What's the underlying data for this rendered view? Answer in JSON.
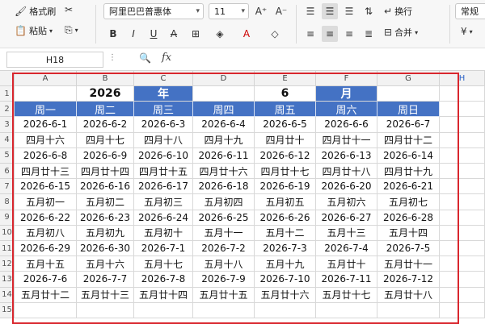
{
  "toolbar": {
    "format_painter": "格式刷",
    "paste": "粘贴",
    "font_name": "阿里巴巴普惠体",
    "font_size": "11",
    "increase_font": "A⁺",
    "decrease_font": "A⁻",
    "wrap_text": "换行",
    "merge": "合并",
    "number_format": "常规"
  },
  "formula_bar": {
    "name_box": "H18",
    "fx": "fx"
  },
  "columns": [
    "A",
    "B",
    "C",
    "D",
    "E",
    "F",
    "G",
    "H"
  ],
  "rows": [
    "1",
    "2",
    "3",
    "4",
    "5",
    "6",
    "7",
    "8",
    "9",
    "10",
    "11",
    "12",
    "13",
    "14",
    "15"
  ],
  "sheet": {
    "row1": [
      "",
      "2026",
      "年",
      "",
      "6",
      "月",
      ""
    ],
    "weekdays": [
      "周一",
      "周二",
      "周三",
      "周四",
      "周五",
      "周六",
      "周日"
    ],
    "body": [
      [
        "2026-6-1",
        "2026-6-2",
        "2026-6-3",
        "2026-6-4",
        "2026-6-5",
        "2026-6-6",
        "2026-6-7"
      ],
      [
        "四月十六",
        "四月十七",
        "四月十八",
        "四月十九",
        "四月廿十",
        "四月廿十一",
        "四月廿十二"
      ],
      [
        "2026-6-8",
        "2026-6-9",
        "2026-6-10",
        "2026-6-11",
        "2026-6-12",
        "2026-6-13",
        "2026-6-14"
      ],
      [
        "四月廿十三",
        "四月廿十四",
        "四月廿十五",
        "四月廿十六",
        "四月廿十七",
        "四月廿十八",
        "四月廿十九"
      ],
      [
        "2026-6-15",
        "2026-6-16",
        "2026-6-17",
        "2026-6-18",
        "2026-6-19",
        "2026-6-20",
        "2026-6-21"
      ],
      [
        "五月初一",
        "五月初二",
        "五月初三",
        "五月初四",
        "五月初五",
        "五月初六",
        "五月初七"
      ],
      [
        "2026-6-22",
        "2026-6-23",
        "2026-6-24",
        "2026-6-25",
        "2026-6-26",
        "2026-6-27",
        "2026-6-28"
      ],
      [
        "五月初八",
        "五月初九",
        "五月初十",
        "五月十一",
        "五月十二",
        "五月十三",
        "五月十四"
      ],
      [
        "2026-6-29",
        "2026-6-30",
        "2026-7-1",
        "2026-7-2",
        "2026-7-3",
        "2026-7-4",
        "2026-7-5"
      ],
      [
        "五月十五",
        "五月十六",
        "五月十七",
        "五月十八",
        "五月十九",
        "五月廿十",
        "五月廿十一"
      ],
      [
        "2026-7-6",
        "2026-7-7",
        "2026-7-8",
        "2026-7-9",
        "2026-7-10",
        "2026-7-11",
        "2026-7-12"
      ],
      [
        "五月廿十二",
        "五月廿十三",
        "五月廿十四",
        "五月廿十五",
        "五月廿十六",
        "五月廿十七",
        "五月廿十八"
      ]
    ]
  },
  "colors": {
    "header_blue": "#4472c4",
    "highlight_red": "#d9272e"
  },
  "icons": [
    "scissors-icon",
    "paste-icon",
    "copy-format-icon",
    "bold-icon",
    "italic-icon",
    "underline-icon",
    "fill-color-icon",
    "font-color-icon",
    "align-left-icon",
    "align-center-icon",
    "align-right-icon",
    "zoom-icon"
  ]
}
